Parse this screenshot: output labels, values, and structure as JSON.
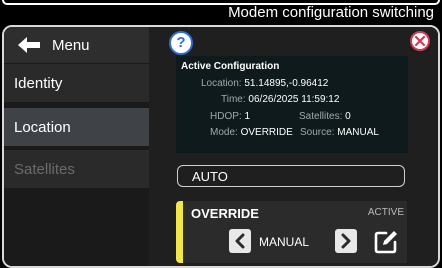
{
  "caption": "Modem configuration switching",
  "sidebar": {
    "menu_label": "Menu",
    "items": [
      {
        "label": "Identity",
        "state": "normal"
      },
      {
        "label": "Location",
        "state": "active"
      },
      {
        "label": "Satellites",
        "state": "disabled"
      }
    ]
  },
  "toolbar": {
    "help_icon": "help-icon",
    "help_glyph": "?",
    "close_icon": "close-icon"
  },
  "active_config": {
    "title": "Active Configuration",
    "location_label": "Location:",
    "location_value": "51.14895,-0.96412",
    "time_label": "Time:",
    "time_value": "06/26/2025 11:59:12",
    "hdop_label": "HDOP:",
    "hdop_value": "1",
    "satellites_label": "Satellites:",
    "satellites_value": "0",
    "mode_label": "Mode:",
    "mode_value": "OVERRIDE",
    "source_label": "Source:",
    "source_value": "MANUAL"
  },
  "options": {
    "auto_label": "AUTO",
    "override_label": "OVERRIDE",
    "override_badge": "ACTIVE",
    "override_mode_value": "MANUAL"
  },
  "colors": {
    "accent_yellow": "#f1e64d",
    "help_blue": "#2f6fd6",
    "close_red": "#d23a55",
    "active_sidebar": "#3f4347"
  }
}
